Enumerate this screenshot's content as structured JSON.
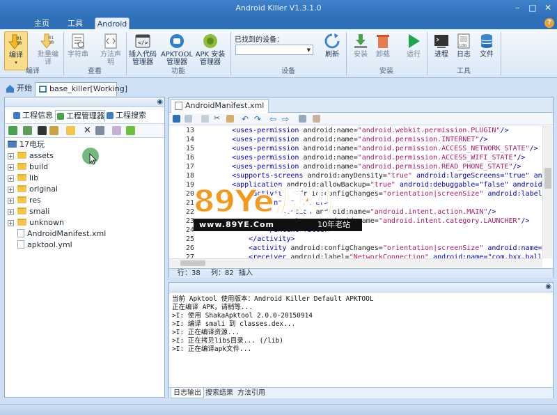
{
  "window": {
    "title": "Android Killer V1.3.1.0",
    "min": "–",
    "max": "□",
    "close": "✕"
  },
  "ribbon_tabs": [
    {
      "label": "主页"
    },
    {
      "label": "工具"
    },
    {
      "label": "Android"
    }
  ],
  "help": "?",
  "ribbon": {
    "compile": {
      "label": "编译",
      "arrow": "▾",
      "icon": "compile-icon"
    },
    "batch_compile": {
      "label": "批量编译",
      "icon": "batch-compile-icon"
    },
    "string": {
      "label": "字符串",
      "icon": "string-icon"
    },
    "method_decl": {
      "label": "方法声明",
      "icon": "method-declaration-icon"
    },
    "insert_code": {
      "label": "插入代码管理器",
      "icon": "insert-code-icon"
    },
    "apktool": {
      "label": "APKTOOL管理器",
      "icon": "apktool-icon"
    },
    "apk_install": {
      "label": "APK 安装管理器",
      "icon": "apk-install-icon"
    },
    "device_label": "已找到的设备：",
    "device_value": "",
    "refresh": {
      "label": "刷新",
      "icon": "refresh-icon"
    },
    "install": {
      "label": "安装",
      "icon": "install-icon"
    },
    "uninstall": {
      "label": "卸载",
      "icon": "uninstall-icon"
    },
    "run": {
      "label": "运行",
      "icon": "run-icon"
    },
    "process": {
      "label": "进程",
      "icon": "process-icon"
    },
    "log": {
      "label": "日志",
      "icon": "log-icon",
      "icon_text": "LOG"
    },
    "file": {
      "label": "文件",
      "icon": "file-icon"
    },
    "groups": {
      "compile": "编译",
      "view": "查看",
      "function": "功能",
      "device": "设备",
      "install": "安装",
      "tools": "工具"
    },
    "colors": {
      "accent_blue": "#2f6fb8",
      "run_green": "#1ea64b",
      "compile_yellow": "#f2b925"
    }
  },
  "doc_tabs": [
    {
      "label": "开始",
      "icon": "home-icon"
    },
    {
      "label": "base_killer[Working]",
      "icon": "project-icon"
    }
  ],
  "left_panel": {
    "eye": "◉",
    "tabs": [
      {
        "label": "工程信息",
        "icon": "project-info-icon"
      },
      {
        "label": "工程管理器",
        "icon": "project-manager-icon"
      },
      {
        "label": "工程搜索",
        "icon": "project-search-icon"
      }
    ],
    "toolbar_icons": [
      "refresh-tree-icon",
      "save-icon",
      "terminal-icon",
      "find-icon",
      "folder-open-icon",
      "delete-icon",
      "rename-icon",
      "copy-icon",
      "add-icon"
    ],
    "tree": {
      "root": "17电玩",
      "items": [
        {
          "label": "assets",
          "type": "folder",
          "expander": "+"
        },
        {
          "label": "build",
          "type": "folder",
          "expander": "+"
        },
        {
          "label": "lib",
          "type": "folder",
          "expander": "+"
        },
        {
          "label": "original",
          "type": "folder",
          "expander": "+"
        },
        {
          "label": "res",
          "type": "folder",
          "expander": "+"
        },
        {
          "label": "smali",
          "type": "folder",
          "expander": "+"
        },
        {
          "label": "unknown",
          "type": "folder",
          "expander": "+"
        },
        {
          "label": "AndroidManifest.xml",
          "type": "file",
          "expander": ""
        },
        {
          "label": "apktool.yml",
          "type": "file",
          "expander": ""
        }
      ]
    }
  },
  "editor": {
    "tab": "AndroidManifest.xml",
    "lines": [
      {
        "n": "13",
        "pre": "    ",
        "tag": "<uses-permission",
        "attr": " android:name=",
        "val": "\"android.webkit.permission.PLUGIN\"",
        "end": "/>"
      },
      {
        "n": "14",
        "pre": "    ",
        "tag": "<uses-permission",
        "attr": " android:name=",
        "val": "\"android.permission.INTERNET\"",
        "end": "/>"
      },
      {
        "n": "15",
        "pre": "    ",
        "tag": "<uses-permission",
        "attr": " android:name=",
        "val": "\"android.permission.ACCESS_NETWORK_STATE\"",
        "end": "/>"
      },
      {
        "n": "16",
        "pre": "    ",
        "tag": "<uses-permission",
        "attr": " android:name=",
        "val": "\"android.permission.ACCESS_WIFI_STATE\"",
        "end": "/>"
      },
      {
        "n": "17",
        "pre": "    ",
        "tag": "<uses-permission",
        "attr": " android:name=",
        "val": "\"android.permission.READ_PHONE_STATE\"",
        "end": "/>"
      },
      {
        "n": "18",
        "pre": "    ",
        "tag": "<supports-screens",
        "attr": " android:anyDensity=",
        "val": "\"true\"",
        "end": " android:largeScreens=\"true\" and"
      },
      {
        "n": "19",
        "pre": "    ",
        "tag": "<application",
        "attr": " android:allowBackup=",
        "val": "\"true\"",
        "end": " android:debuggable=\"false\" android:"
      },
      {
        "n": "20",
        "pre": "        ",
        "tag": "<activity",
        "attr": " android:configChanges=",
        "val": "\"orientation|screenSize\"",
        "end": " android:label="
      },
      {
        "n": "21",
        "pre": "            ",
        "tag": "<intent-filter>",
        "attr": "",
        "val": "",
        "end": ""
      },
      {
        "n": "22",
        "pre": "                ",
        "tag": "<action",
        "attr": " android:name=",
        "val": "\"android.intent.action.MAIN\"",
        "end": "/>"
      },
      {
        "n": "23",
        "pre": "                ",
        "tag": "<category",
        "attr": " android:name=",
        "val": "\"android.intent.category.LAUNCHER\"",
        "end": "/>"
      },
      {
        "n": "24",
        "pre": "            ",
        "tag": "</intent-filter>",
        "attr": "",
        "val": "",
        "end": ""
      },
      {
        "n": "25",
        "pre": "        ",
        "tag": "</activity>",
        "attr": "",
        "val": "",
        "end": ""
      },
      {
        "n": "26",
        "pre": "        ",
        "tag": "<activity",
        "attr": " android:configChanges=",
        "val": "\"orientation|screenSize\"",
        "end": " android:name=\""
      },
      {
        "n": "27",
        "pre": "        ",
        "tag": "<receiver",
        "attr": " android:label=",
        "val": "\"NetworkConnection\"",
        "end": " android:name=\"com.bxx.ball"
      }
    ],
    "status": {
      "row": "行：38",
      "col": "列：82",
      "mode": "插入"
    }
  },
  "log": {
    "eye": "◉",
    "lines": [
      "当前 Apktool 使用版本：Android Killer Default APKTOOL",
      "正在编译 APK，请稍等...",
      ">I: 使用 ShakaApktool 2.0.0-20150914",
      ">I: 编译 smali 到 classes.dex...",
      ">I: 正在编译资源...",
      ">I: 正在拷贝libs目录... (/lib)",
      ">I: 正在编译apk文件..."
    ],
    "tabs": [
      "日志输出",
      "搜索结果",
      "方法引用"
    ]
  },
  "watermark": {
    "big": "89Ye源码",
    "url": "www.89YE.Com",
    "slogan": "10年老站",
    "color": "#f39a1e"
  }
}
